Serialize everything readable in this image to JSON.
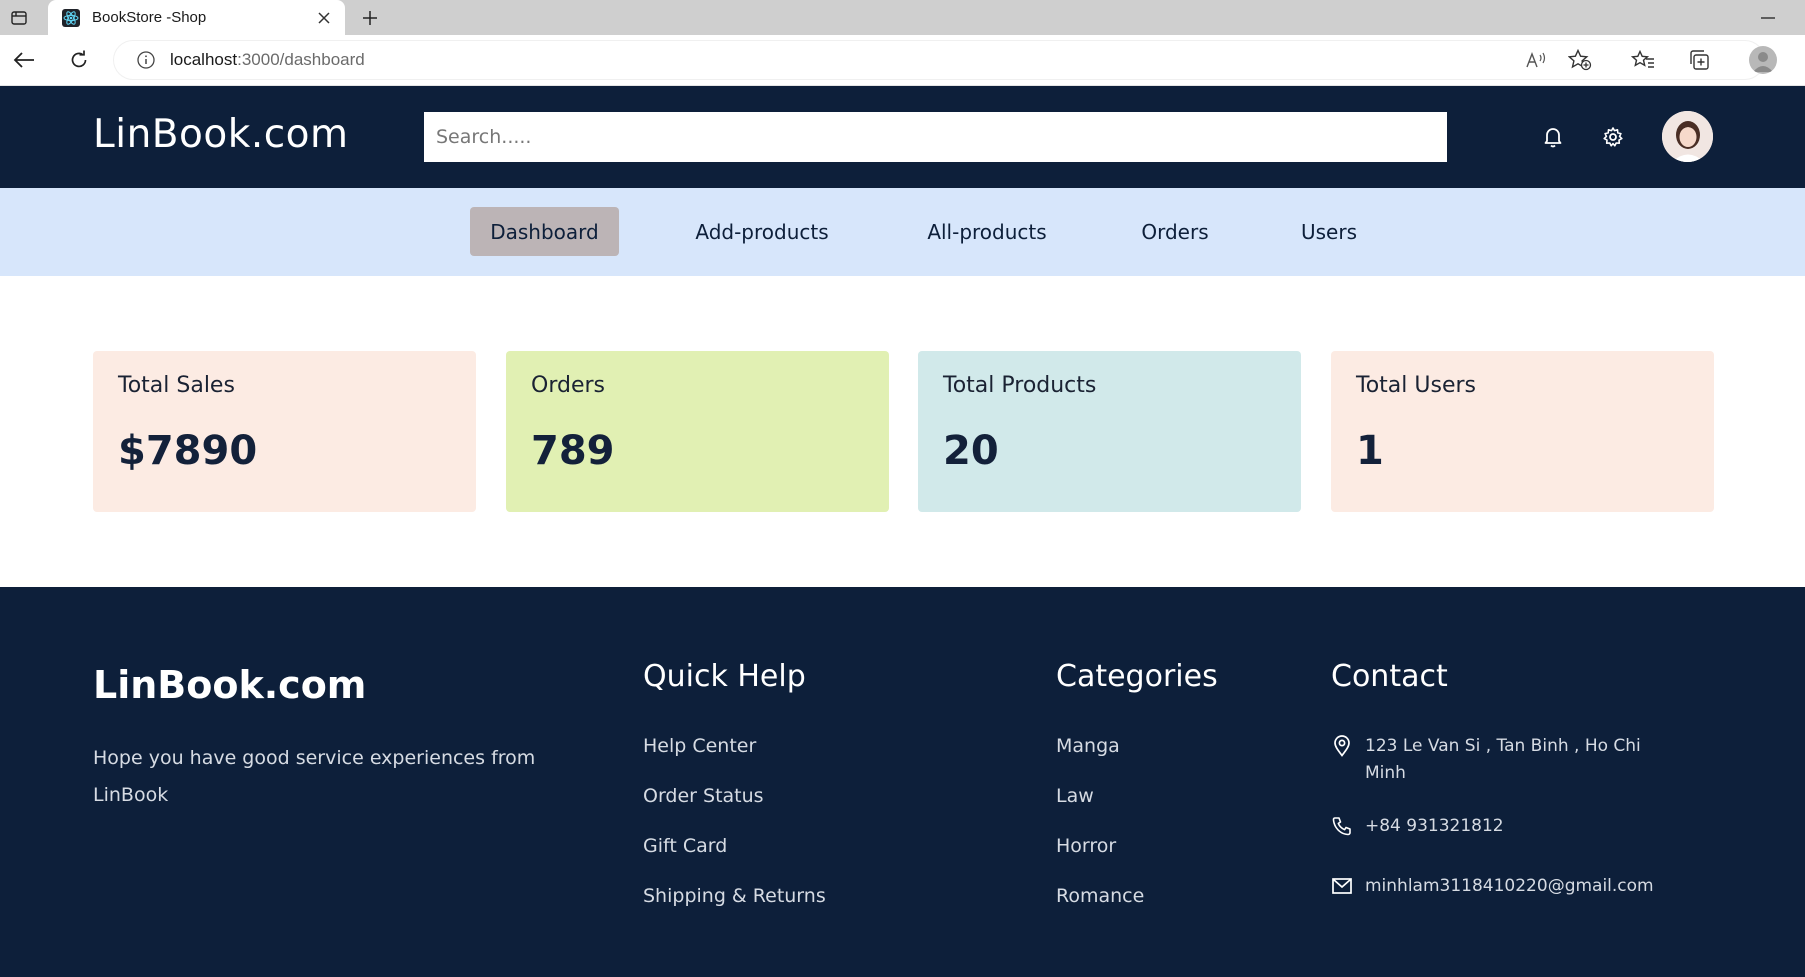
{
  "browser": {
    "tab_title": "BookStore -Shop",
    "url_host": "localhost",
    "url_rest": ":3000/dashboard"
  },
  "header": {
    "logo": "LinBook.com",
    "search_placeholder": "Search....."
  },
  "nav": {
    "items": [
      {
        "label": "Dashboard",
        "active": true
      },
      {
        "label": "Add-products",
        "active": false
      },
      {
        "label": "All-products",
        "active": false
      },
      {
        "label": "Orders",
        "active": false
      },
      {
        "label": "Users",
        "active": false
      }
    ]
  },
  "stats": [
    {
      "label": "Total Sales",
      "value": "$7890",
      "color": "#fcebe3"
    },
    {
      "label": "Orders",
      "value": "789",
      "color": "#e1f0b3"
    },
    {
      "label": "Total Products",
      "value": "20",
      "color": "#d1e9ea"
    },
    {
      "label": "Total Users",
      "value": "1",
      "color": "#fcebe3"
    }
  ],
  "footer": {
    "logo": "LinBook.com",
    "tagline": "Hope you have good service experiences from LinBook",
    "quick_help": {
      "heading": "Quick Help",
      "links": [
        "Help Center",
        "Order Status",
        "Gift Card",
        "Shipping & Returns"
      ]
    },
    "categories": {
      "heading": "Categories",
      "links": [
        "Manga",
        "Law",
        "Horror",
        "Romance"
      ]
    },
    "contact": {
      "heading": "Contact",
      "address": "123 Le Van Si , Tan Binh , Ho Chi Minh",
      "phone": "+84 931321812",
      "email": "minhlam3118410220@gmail.com"
    }
  },
  "colors": {
    "navy": "#0d1f3a",
    "subnav": "#d7e6fb",
    "active_nav": "#bcb4b6"
  },
  "icons": {
    "header": [
      "bell-icon",
      "gear-icon"
    ],
    "contact": [
      "location-pin-icon",
      "phone-icon",
      "mail-icon"
    ]
  }
}
